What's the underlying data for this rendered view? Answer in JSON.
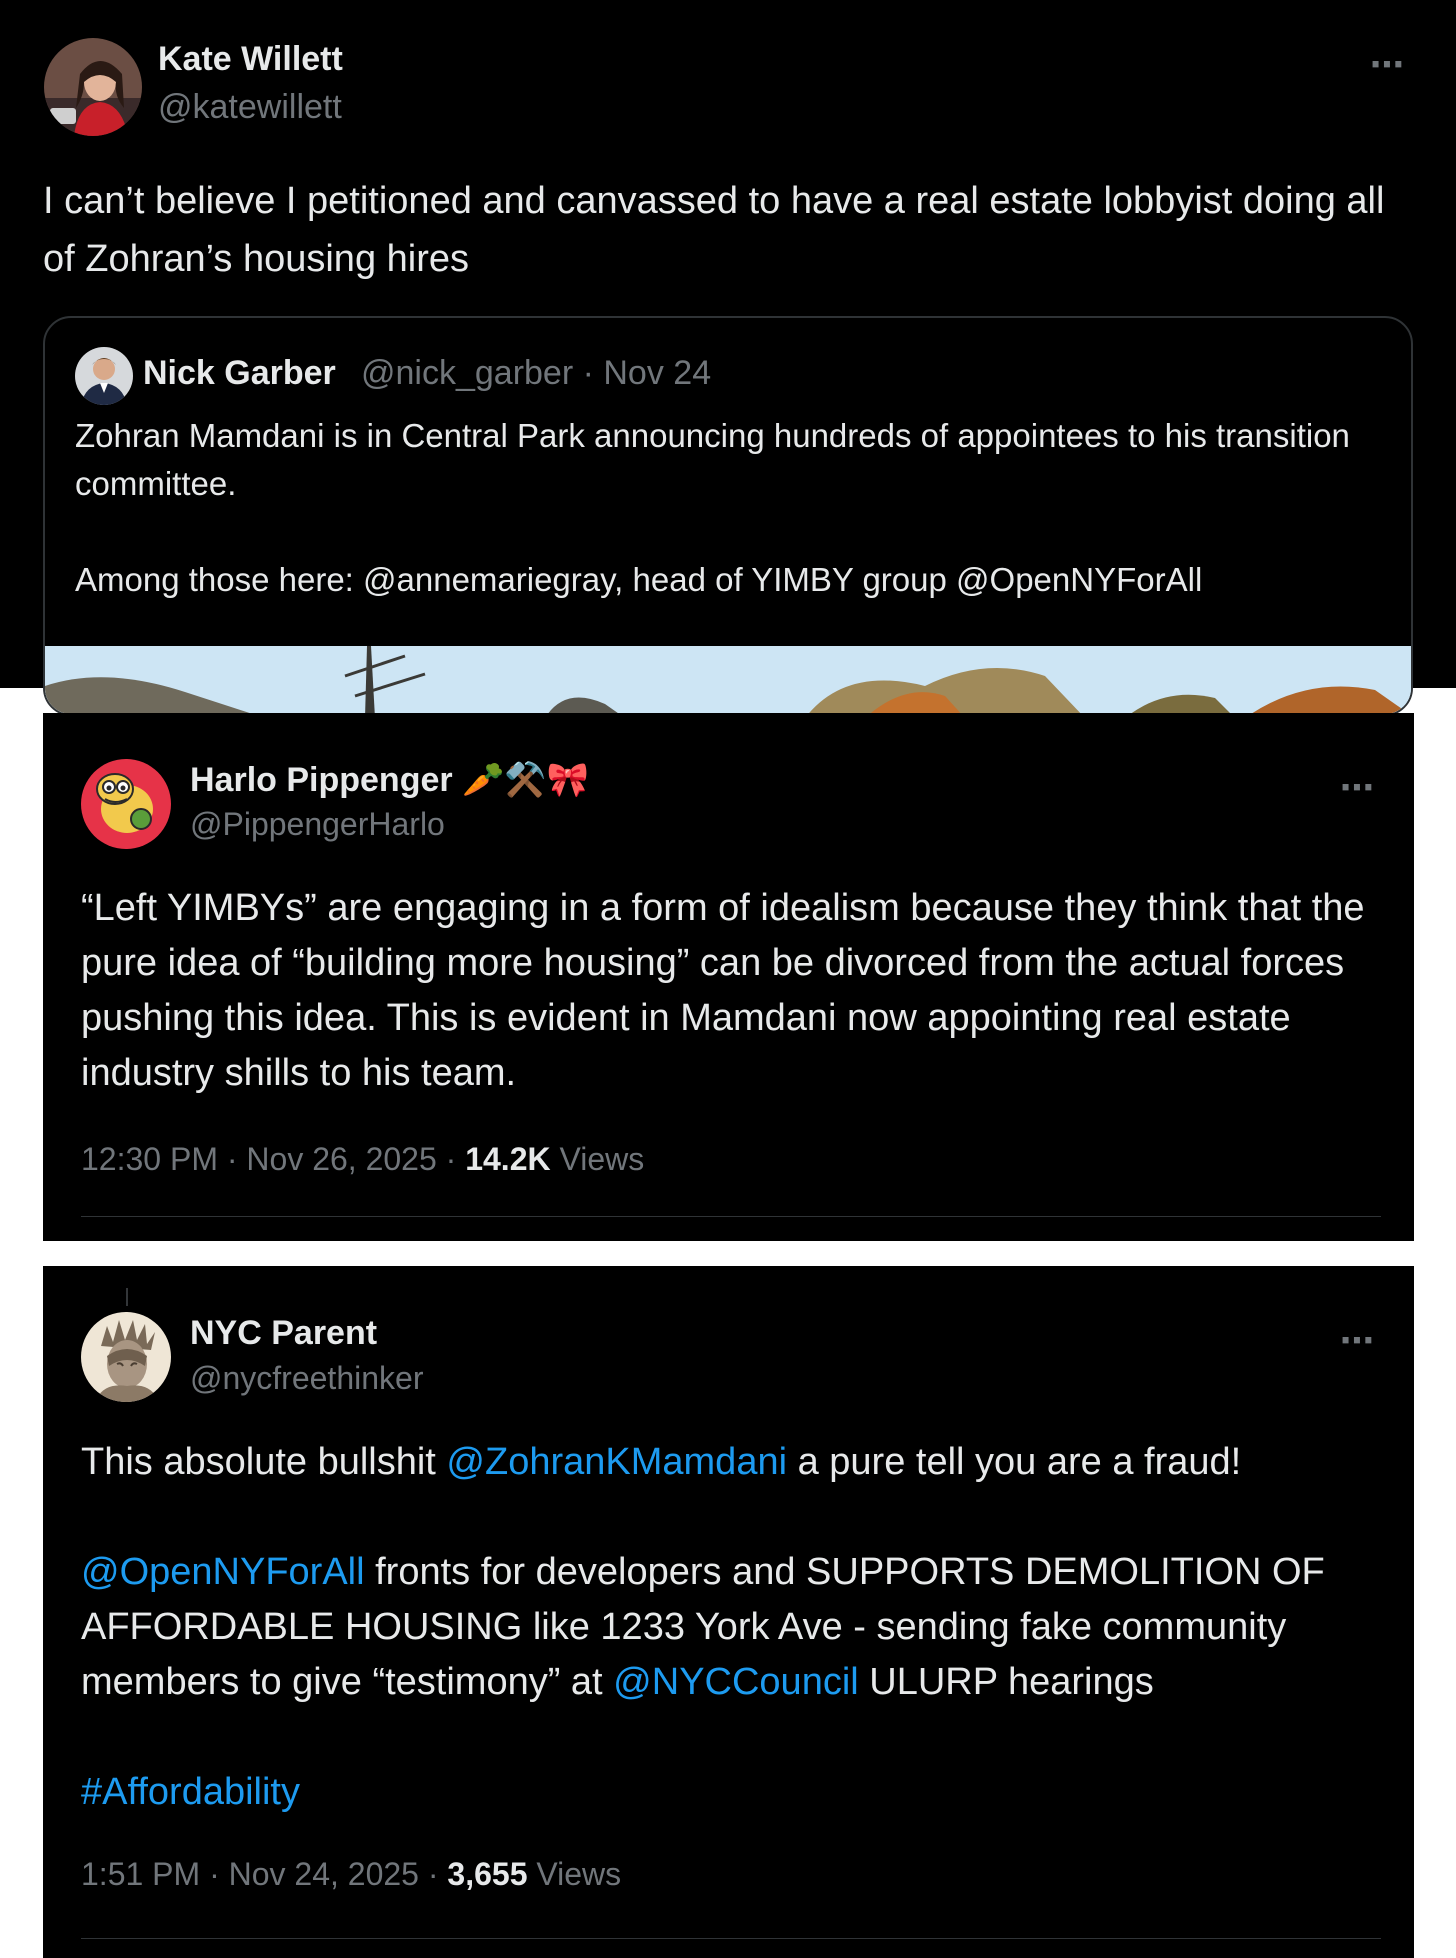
{
  "tweet1": {
    "author_name": "Kate Willett",
    "author_handle": "@katewillett",
    "text": "I can’t believe I petitioned and canvassed to have a real estate lobbyist doing all of Zohran’s housing hires",
    "quote": {
      "author_name": "Nick Garber",
      "author_handle_date": "@nick_garber · Nov 24",
      "text": "Zohran Mamdani is in Central Park announcing hundreds of appointees to his transition committee.\n\nAmong those here: @annemariegray, head of YIMBY group @OpenNYForAll"
    }
  },
  "tweet2": {
    "author_name": "Harlo Pippenger 🥕⚒️🎀",
    "author_handle": "@PippengerHarlo",
    "text": "“Left YIMBYs” are engaging in a form of idealism because they think that the pure idea of “building more housing” can be divorced from the actual forces pushing this idea. This is evident in Mamdani now appointing real estate industry shills to his team.",
    "timestamp": "12:30 PM · Nov 26, 2025 · ",
    "views_count": "14.2K",
    "views_label": " Views"
  },
  "tweet3": {
    "author_name": "NYC Parent",
    "author_handle": "@nycfreethinker",
    "p1_a": "This absolute bullshit ",
    "p1_mention": "@ZohranKMamdani",
    "p1_b": " a pure tell you are a fraud!",
    "p2_mention1": "@OpenNYForAll",
    "p2_a": " fronts for developers and SUPPORTS DEMOLITION OF AFFORDABLE HOUSING like 1233 York Ave - sending fake community members to give “testimony” at ",
    "p2_mention2": "@NYCCouncil",
    "p2_b": " ULURP hearings",
    "hashtag": "#Affordability",
    "timestamp": "1:51 PM · Nov 24, 2025 · ",
    "views_count": "3,655",
    "views_label": " Views"
  },
  "icons": {
    "more": "⋯"
  },
  "colors": {
    "background": "#000000",
    "text": "#e7e9ea",
    "muted": "#71767b",
    "link": "#1d9bf0",
    "border": "#2f3336"
  }
}
